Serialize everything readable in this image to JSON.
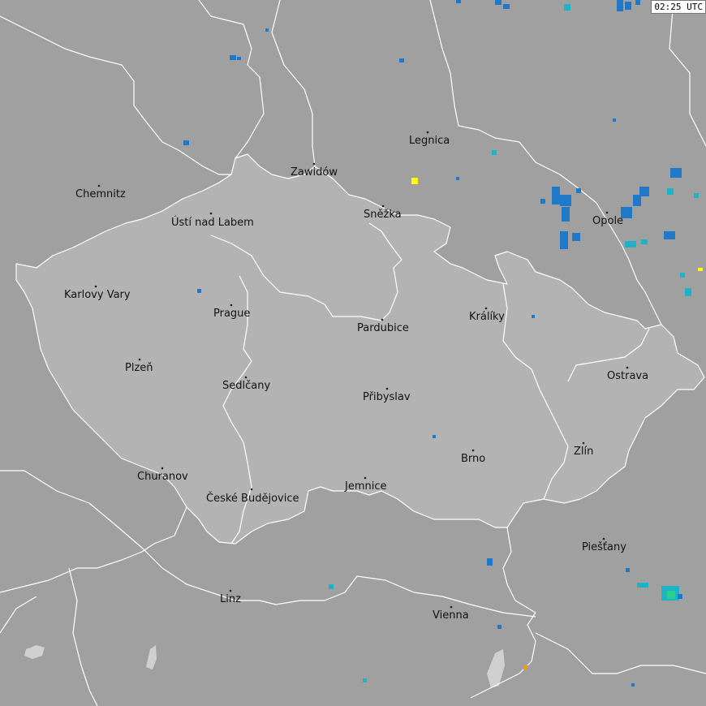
{
  "timestamp": "02:25 UTC",
  "colors": {
    "background": "#a0a0a0",
    "czech_region": "#b3b3b3",
    "border": "#ffffff",
    "lake": "#d0d0d0",
    "strike_blue": "#1f78c8",
    "strike_cyan": "#1eb4c8",
    "strike_yellow": "#ffff00",
    "strike_orange": "#ff9900"
  },
  "cities": [
    {
      "name": "Chemnitz"
    },
    {
      "name": "Ústí nad Labem"
    },
    {
      "name": "Karlovy Vary"
    },
    {
      "name": "Prague"
    },
    {
      "name": "Plzeň"
    },
    {
      "name": "Sedlčany"
    },
    {
      "name": "Churanov"
    },
    {
      "name": "České Budějovice"
    },
    {
      "name": "Jemnice"
    },
    {
      "name": "Přibyslav"
    },
    {
      "name": "Pardubice"
    },
    {
      "name": "Králíky"
    },
    {
      "name": "Brno"
    },
    {
      "name": "Zlín"
    },
    {
      "name": "Ostrava"
    },
    {
      "name": "Opole"
    },
    {
      "name": "Legnica"
    },
    {
      "name": "Zawidów"
    },
    {
      "name": "Sněžka"
    },
    {
      "name": "Piešťany"
    },
    {
      "name": "Linz"
    },
    {
      "name": "Vienna"
    }
  ]
}
